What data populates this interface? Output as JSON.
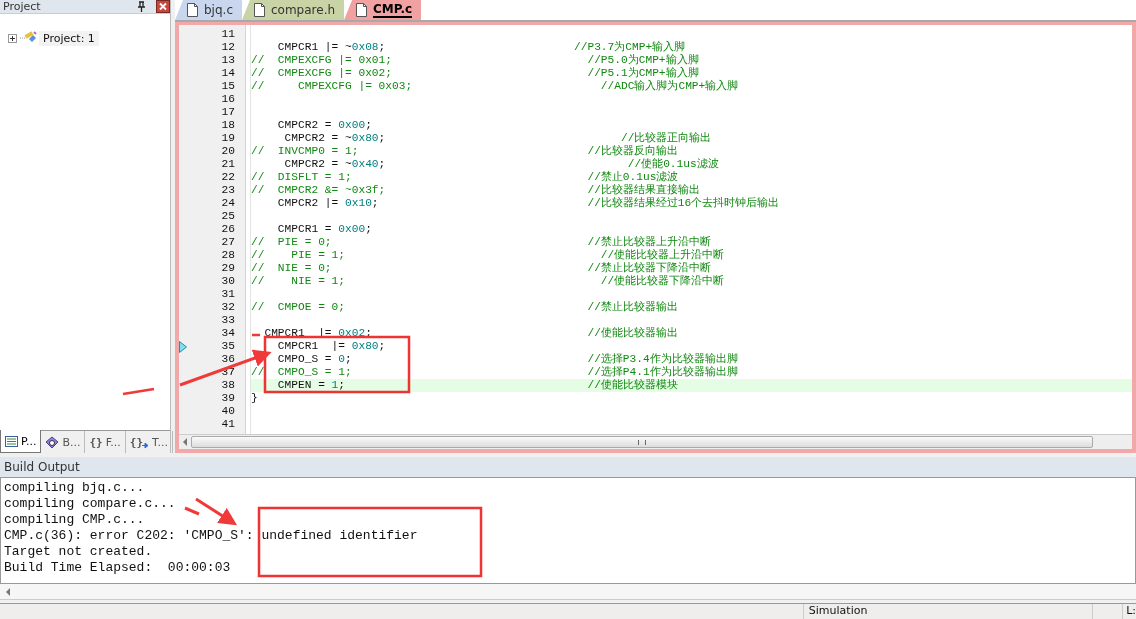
{
  "project_panel": {
    "title": "Project",
    "tree": [
      {
        "label": "Project: 1",
        "expanded": false
      }
    ],
    "tabs": [
      {
        "label": "P...",
        "selected": true
      },
      {
        "label": "B...",
        "selected": false
      },
      {
        "label": "F...",
        "glyph": "{}",
        "selected": false
      },
      {
        "label": "T...",
        "glyph": "{}",
        "selected": false
      }
    ]
  },
  "editor": {
    "tabs": [
      {
        "label": "bjq.c",
        "color": "#c9d7ee",
        "selected": false
      },
      {
        "label": "compare.h",
        "color": "#c8d3a6",
        "selected": false
      },
      {
        "label": "CMP.c",
        "color": "#f1a1a1",
        "selected": true
      }
    ],
    "lines": [
      {
        "num": "11"
      },
      {
        "num": "12",
        "code": "    CMPCR1 |= ~",
        "value": "0x08",
        "tail": ";",
        "comment": "//P3.7为CMP+输入脚",
        "commented": false
      },
      {
        "num": "13",
        "code": "//  CMPEXCFG |= 0x01;",
        "comment": "  //P5.0为CMP+输入脚",
        "commented": true
      },
      {
        "num": "14",
        "code": "//  CMPEXCFG |= 0x02;",
        "comment": "  //P5.1为CMP+输入脚",
        "commented": true
      },
      {
        "num": "15",
        "code": "//     CMPEXCFG |= 0x03;",
        "comment": "    //ADC输入脚为CMP+输入脚",
        "commented": true
      },
      {
        "num": "16"
      },
      {
        "num": "17"
      },
      {
        "num": "18",
        "code": "    CMPCR2 = ",
        "value": "0x00",
        "tail": ";",
        "commented": false
      },
      {
        "num": "19",
        "code": "     CMPCR2 = ~",
        "value": "0x80",
        "tail": ";",
        "comment": "       //比较器正向输出",
        "commented": false
      },
      {
        "num": "20",
        "code": "//  INVCMP0 = 1;",
        "comment": "  //比较器反向输出",
        "commented": true
      },
      {
        "num": "21",
        "code": "     CMPCR2 = ~",
        "value": "0x40",
        "tail": ";",
        "comment": "        //使能0.1us滤波",
        "commented": false
      },
      {
        "num": "22",
        "code": "//  DISFLT = 1;",
        "comment": "  //禁止0.1us滤波",
        "commented": true
      },
      {
        "num": "23",
        "code": "//  CMPCR2 &= ~0x3f;",
        "comment": "  //比较器结果直接输出",
        "commented": true
      },
      {
        "num": "24",
        "code": "    CMPCR2 |= ",
        "value": "0x10",
        "tail": ";",
        "comment": "  //比较器结果经过16个去抖时钟后输出",
        "commented": false
      },
      {
        "num": "25"
      },
      {
        "num": "26",
        "code": "    CMPCR1 = ",
        "value": "0x00",
        "tail": ";",
        "commented": false
      },
      {
        "num": "27",
        "code": "//  PIE = 0;",
        "comment": "  //禁止比较器上升沿中断",
        "commented": true
      },
      {
        "num": "28",
        "code": "//    PIE = 1;",
        "comment": "    //使能比较器上升沿中断",
        "commented": true
      },
      {
        "num": "29",
        "code": "//  NIE = 0;",
        "comment": "  //禁止比较器下降沿中断",
        "commented": true
      },
      {
        "num": "30",
        "code": "//    NIE = 1;",
        "comment": "    //使能比较器下降沿中断",
        "commented": true
      },
      {
        "num": "31"
      },
      {
        "num": "32",
        "code": "//  CMPOE = 0;",
        "comment": "  //禁止比较器输出",
        "commented": true
      },
      {
        "num": "33"
      },
      {
        "num": "34",
        "code": "  CMPCR1  |= ",
        "value": "0x02",
        "tail": ";",
        "comment": "  //使能比较器输出",
        "commented": false
      },
      {
        "num": "35",
        "code": "    CMPCR1  |= ",
        "value": "0x80",
        "tail": ";",
        "commented": false,
        "marker": true
      },
      {
        "num": "36",
        "code": "    CMPO_S = ",
        "value": "0",
        "tail": ";",
        "comment": "  //选择P3.4作为比较器输出脚",
        "commented": false
      },
      {
        "num": "37",
        "code": "//  CMPO_S = 1;",
        "comment": "  //选择P4.1作为比较器输出脚",
        "commented": true
      },
      {
        "num": "38",
        "code": "    CMPEN = ",
        "value": "1",
        "tail": ";",
        "comment": "  //使能比较器模块",
        "commented": false,
        "current": true
      },
      {
        "num": "39",
        "code": "}",
        "commented": false
      },
      {
        "num": "40"
      },
      {
        "num": "41"
      }
    ]
  },
  "build_output": {
    "title": "Build Output",
    "lines": [
      "compiling bjq.c...",
      "compiling compare.c...",
      "compiling CMP.c...",
      "CMP.c(36): error C202: 'CMPO_S': undefined identifier",
      "Target not created.",
      "Build Time Elapsed:  00:00:03"
    ]
  },
  "status_bar": [
    "Simulation",
    "L:"
  ]
}
